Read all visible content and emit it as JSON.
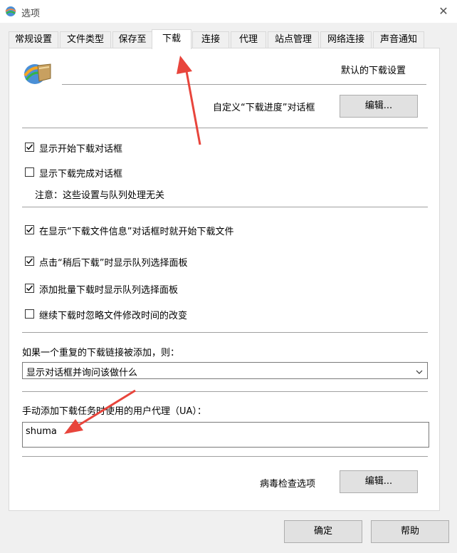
{
  "window": {
    "title": "选项",
    "close_glyph": "✕",
    "app_icon": "idm-globe-icon"
  },
  "tabs": [
    {
      "label": "常规设置",
      "active": false
    },
    {
      "label": "文件类型",
      "active": false
    },
    {
      "label": "保存至",
      "active": false
    },
    {
      "label": "下载",
      "active": true
    },
    {
      "label": "连接",
      "active": false
    },
    {
      "label": "代理",
      "active": false
    },
    {
      "label": "站点管理",
      "active": false
    },
    {
      "label": "网络连接",
      "active": false
    },
    {
      "label": "声音通知",
      "active": false
    }
  ],
  "header": {
    "section_title": "默认的下载设置",
    "icon": "idm-download-icon"
  },
  "progress_dialog": {
    "label": "自定义“下载进度”对话框",
    "button": "编辑..."
  },
  "checkboxes": [
    {
      "label": "显示开始下载对话框",
      "checked": true
    },
    {
      "label": "显示下载完成对话框",
      "checked": false
    }
  ],
  "note": "注意：这些设置与队列处理无关",
  "checkboxes2": [
    {
      "label": "在显示“下载文件信息”对话框时就开始下载文件",
      "checked": true
    },
    {
      "label": "点击“稍后下载”时显示队列选择面板",
      "checked": true
    },
    {
      "label": "添加批量下载时显示队列选择面板",
      "checked": true
    },
    {
      "label": "继续下载时忽略文件修改时间的改变",
      "checked": false
    }
  ],
  "duplicate": {
    "label": "如果一个重复的下载链接被添加，则：",
    "selected": "显示对话框并询问该做什么"
  },
  "user_agent": {
    "label": "手动添加下载任务时使用的用户代理（UA）：",
    "value": "shuma"
  },
  "virus": {
    "label": "病毒检查选项",
    "button": "编辑..."
  },
  "footer": {
    "ok": "确定",
    "help": "帮助"
  },
  "colors": {
    "annotation_arrow": "#e8453c",
    "check": "#000000"
  }
}
